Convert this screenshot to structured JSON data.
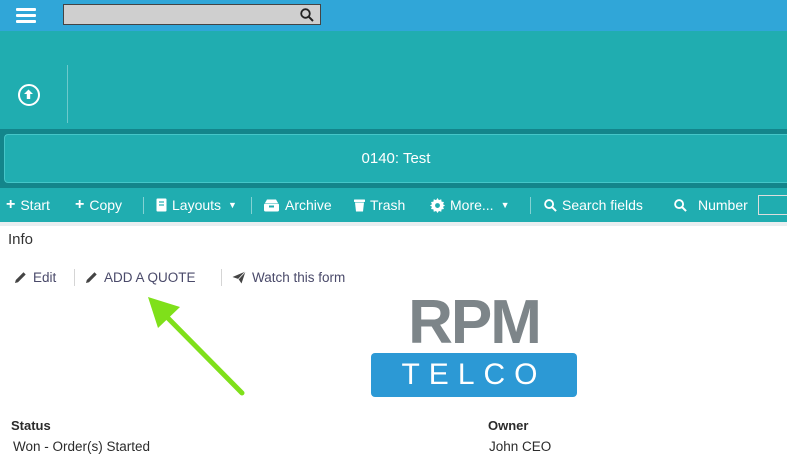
{
  "search": {
    "placeholder": "",
    "value": ""
  },
  "record": {
    "title": "0140: Test"
  },
  "toolbar": {
    "start": "Start",
    "copy": "Copy",
    "layouts": "Layouts",
    "archive": "Archive",
    "trash": "Trash",
    "more": "More...",
    "search_fields": "Search fields",
    "number": "Number"
  },
  "section": {
    "title": "Info"
  },
  "actions": {
    "edit": "Edit",
    "add_quote": "ADD A QUOTE",
    "watch": "Watch this form"
  },
  "logo": {
    "top": "RPM",
    "bottom": "TELCO"
  },
  "fields": {
    "status_label": "Status",
    "status_value": "Won - Order(s) Started",
    "owner_label": "Owner",
    "owner_value": "John CEO"
  },
  "colors": {
    "topbar": "#30a6d8",
    "teal": "#20adb0",
    "teal_dark": "#13858b",
    "logo_blue": "#2c99d5",
    "logo_gray": "#7d8589",
    "annotation_arrow": "#7fe01a"
  },
  "icons": [
    "hamburger-menu-icon",
    "search-icon",
    "upload-icon",
    "plus-icon",
    "book-icon",
    "chevron-down-icon",
    "archive-icon",
    "trash-icon",
    "gear-icon",
    "pencil-icon",
    "paper-plane-icon"
  ]
}
